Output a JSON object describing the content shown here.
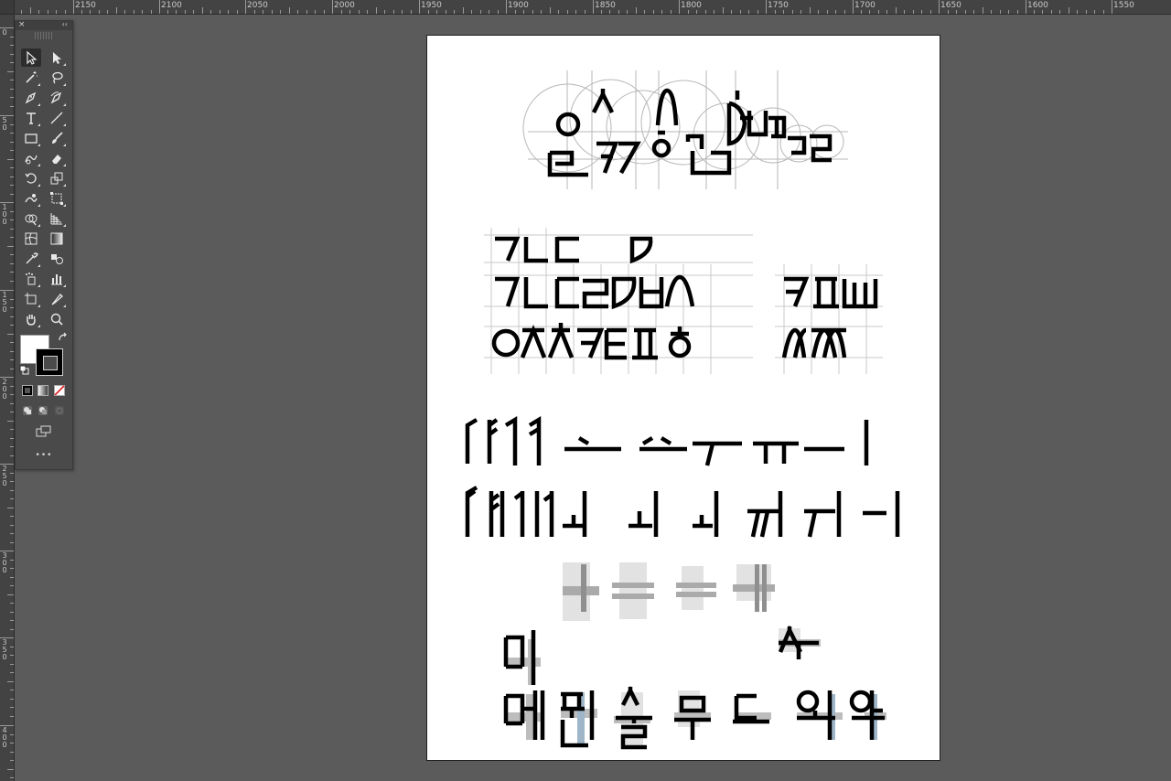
{
  "ruler": {
    "top_labels": [
      "2150",
      "2100",
      "2050",
      "2000",
      "1950",
      "1900",
      "1850",
      "1800",
      "1750",
      "1700",
      "1650",
      "1600",
      "1550"
    ],
    "left_labels": [
      "0",
      "50",
      "100",
      "150",
      "200",
      "250",
      "300",
      "350",
      "400"
    ]
  },
  "toolbar": {
    "close_glyph": "×",
    "collapse_glyph": "‹‹",
    "more_glyph": "•••",
    "tools": [
      "selection-tool",
      "direct-selection-tool",
      "magic-wand-tool",
      "lasso-tool",
      "pen-tool",
      "curvature-tool",
      "type-tool",
      "line-segment-tool",
      "rectangle-tool",
      "paintbrush-tool",
      "shaper-tool",
      "eraser-tool",
      "rotate-tool",
      "scale-tool",
      "warp-tool",
      "free-transform-tool",
      "shape-builder-tool",
      "perspective-grid-tool",
      "mesh-tool",
      "gradient-tool",
      "eyedropper-tool",
      "blend-tool",
      "symbol-sprayer-tool",
      "column-graph-tool",
      "artboard-tool",
      "slice-tool",
      "hand-tool",
      "zoom-tool"
    ],
    "fill_color": "#ffffff",
    "stroke_color": "#000000"
  },
  "artboard": {
    "background": "#ffffff"
  }
}
